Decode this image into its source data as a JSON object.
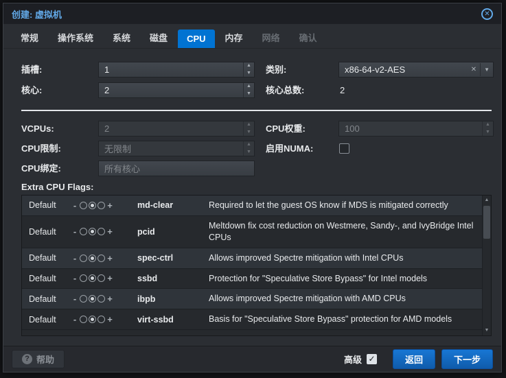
{
  "window": {
    "title": "创建: 虚拟机"
  },
  "icons": {
    "close": "✕",
    "spinner_up": "▲",
    "spinner_down": "▼",
    "clear": "✕",
    "caret_down": "▼",
    "scroll_up": "▲",
    "scroll_down": "▼",
    "help": "?",
    "check": "✓",
    "toggle_minus": "-",
    "toggle_plus": "+"
  },
  "tabs": [
    {
      "label": "常规",
      "state": "normal"
    },
    {
      "label": "操作系统",
      "state": "normal"
    },
    {
      "label": "系统",
      "state": "normal"
    },
    {
      "label": "磁盘",
      "state": "normal"
    },
    {
      "label": "CPU",
      "state": "active"
    },
    {
      "label": "内存",
      "state": "normal"
    },
    {
      "label": "网络",
      "state": "disabled"
    },
    {
      "label": "确认",
      "state": "disabled"
    }
  ],
  "form": {
    "sockets": {
      "label": "插槽:",
      "value": "1"
    },
    "type": {
      "label": "类别:",
      "value": "x86-64-v2-AES"
    },
    "cores": {
      "label": "核心:",
      "value": "2"
    },
    "total_cores": {
      "label": "核心总数:",
      "value": "2"
    },
    "vcpus": {
      "label": "VCPUs:",
      "value": "2",
      "disabled": true
    },
    "cpu_weight": {
      "label": "CPU权重:",
      "value": "100",
      "disabled": true
    },
    "cpu_limit": {
      "label": "CPU限制:",
      "value": "无限制",
      "disabled": true
    },
    "numa": {
      "label": "启用NUMA:",
      "checked": false
    },
    "cpu_affinity": {
      "label": "CPU绑定:",
      "value": "",
      "placeholder": "所有核心"
    }
  },
  "flags": {
    "section_label": "Extra CPU Flags:",
    "rows": [
      {
        "state": "Default",
        "flag": "md-clear",
        "description": "Required to let the guest OS know if MDS is mitigated correctly"
      },
      {
        "state": "Default",
        "flag": "pcid",
        "description": "Meltdown fix cost reduction on Westmere, Sandy-, and IvyBridge Intel CPUs"
      },
      {
        "state": "Default",
        "flag": "spec-ctrl",
        "description": "Allows improved Spectre mitigation with Intel CPUs"
      },
      {
        "state": "Default",
        "flag": "ssbd",
        "description": "Protection for \"Speculative Store Bypass\" for Intel models"
      },
      {
        "state": "Default",
        "flag": "ibpb",
        "description": "Allows improved Spectre mitigation with AMD CPUs"
      },
      {
        "state": "Default",
        "flag": "virt-ssbd",
        "description": "Basis for \"Speculative Store Bypass\" protection for AMD models"
      }
    ]
  },
  "footer": {
    "help_label": "帮助",
    "advanced_label": "高级",
    "advanced_checked": true,
    "back_label": "返回",
    "next_label": "下一步"
  },
  "colors": {
    "accent_blue": "#0173d2",
    "button_blue": "#1467c8",
    "title_blue": "#62a9e8",
    "dialog_bg": "#2b2e33",
    "row_light": "#2f343a",
    "row_dark": "#26292d"
  }
}
